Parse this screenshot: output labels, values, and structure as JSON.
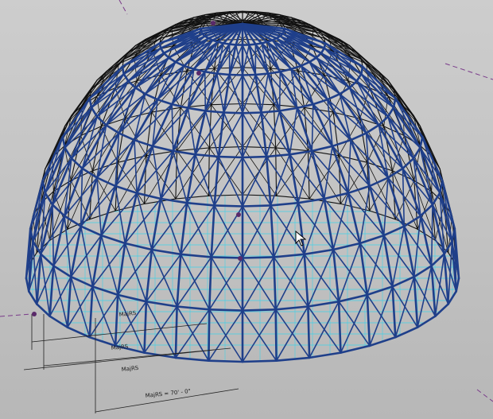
{
  "viewport": {
    "name": "3d-model-view",
    "dimension_labels": {
      "primary": "MajRS = 70' - 0\"",
      "secondary_1": "MajRS",
      "secondary_2": "MajRS",
      "secondary_3": "MajRS"
    }
  },
  "colors": {
    "background": "#c4c4c4",
    "front_frame": "#1f3f8a",
    "back_frame": "#111111",
    "glazing": "#3fd2e8",
    "crop_line": "#7a3a8a",
    "node": "#5a2a6a"
  }
}
